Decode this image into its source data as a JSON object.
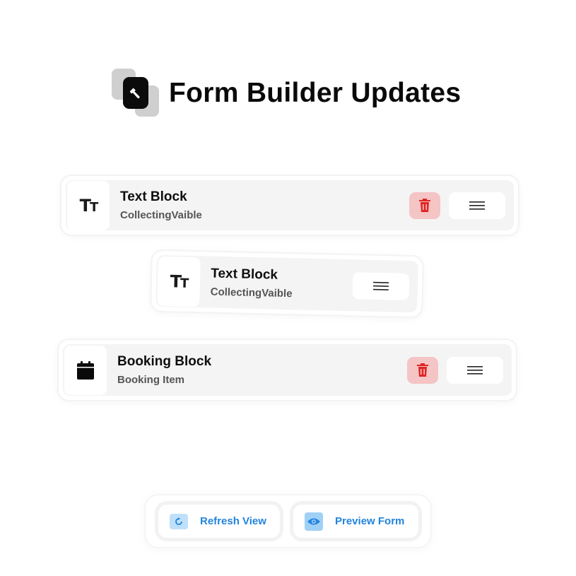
{
  "header": {
    "title": "Form Builder Updates",
    "logo_icon": "wrench-icon"
  },
  "cards": [
    {
      "icon": "text-type-icon",
      "icon_text": "Tт",
      "title": "Text Block",
      "subtitle": "CollectingVaible",
      "has_delete": true
    },
    {
      "icon": "text-type-icon",
      "icon_text": "Tт",
      "title": "Text Block",
      "subtitle": "CollectingVaible",
      "has_delete": false,
      "state": "dragging"
    },
    {
      "icon": "calendar-icon",
      "title": "Booking Block",
      "subtitle": "Booking Item",
      "has_delete": true
    }
  ],
  "footer": {
    "refresh_label": "Refresh View",
    "refresh_icon": "refresh-icon",
    "preview_label": "Preview Form",
    "preview_icon": "eye-icon"
  },
  "colors": {
    "accent": "#2284dd",
    "delete_bg": "#f5c4c4",
    "delete_icon": "#e02424",
    "card_bg": "#f4f4f4"
  }
}
